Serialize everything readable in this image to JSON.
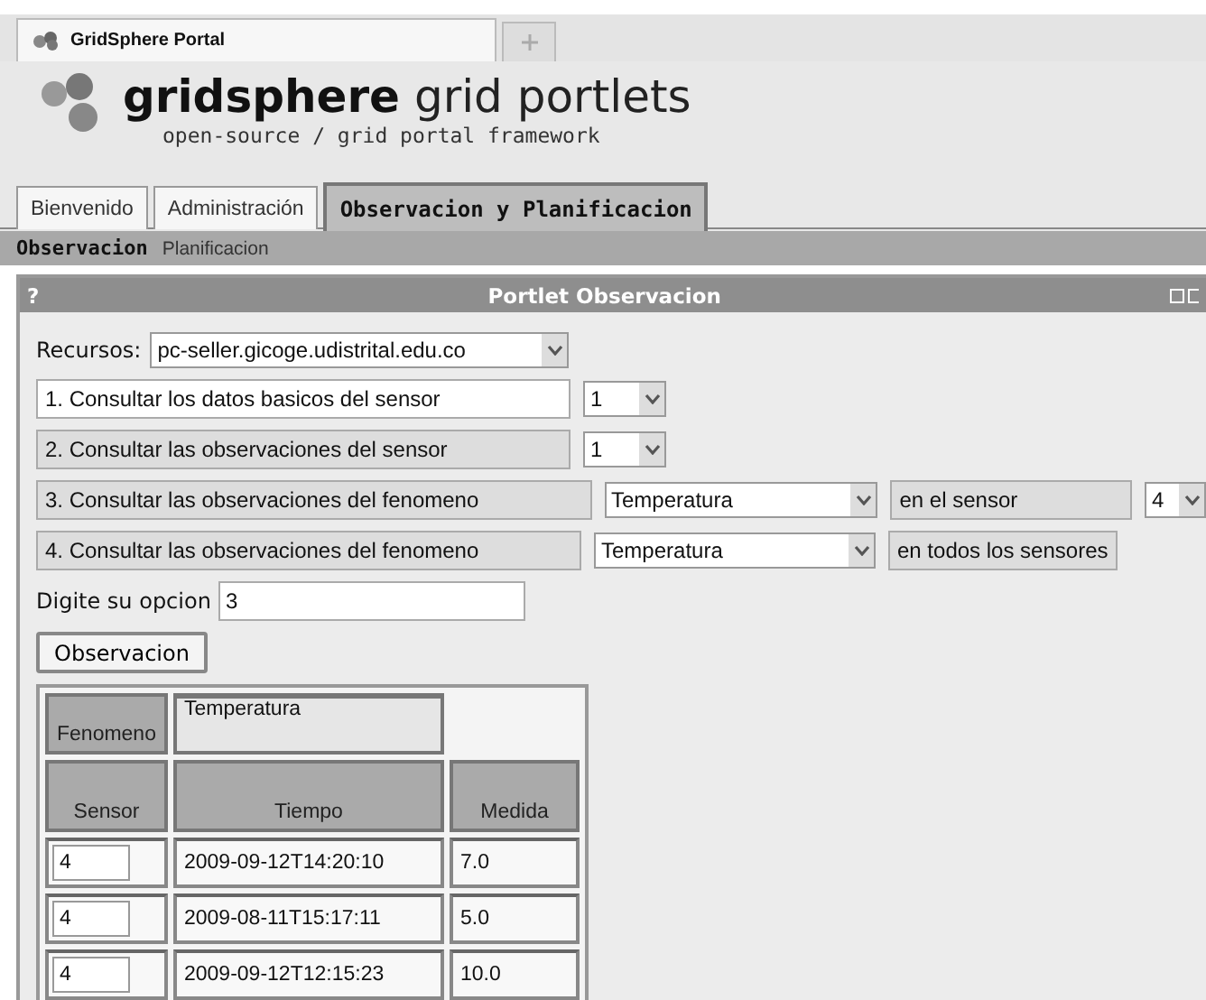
{
  "browser_tab": {
    "title": "GridSphere Portal"
  },
  "header": {
    "title": "**gridsphere** grid portlets",
    "subtitle": "open-source / grid portal framework"
  },
  "tabs": [
    {
      "label": "Bienvenido",
      "selected": false
    },
    {
      "label": "Administración",
      "selected": false
    },
    {
      "label": "Observacion y Planificacion",
      "selected": true
    }
  ],
  "subtabs": [
    {
      "label": "Observacion",
      "selected": true
    },
    {
      "label": "Planificacion",
      "selected": false
    }
  ],
  "portlet": {
    "help": "?",
    "title": "Portlet Observacion",
    "resource": {
      "label": "Recursos:",
      "value": "pc-seller.gicoge.udistrital.edu.co"
    },
    "options": [
      {
        "label": "1. Consultar los datos basicos del sensor",
        "active": true,
        "select": "1"
      },
      {
        "label": "2. Consultar las observaciones del sensor",
        "active": false,
        "select": "1"
      },
      {
        "label": "3. Consultar las observaciones del fenomeno",
        "active": false,
        "select": "Temperatura",
        "suffix": "en el sensor",
        "suffix_select": "4"
      },
      {
        "label": "4. Consultar las observaciones del fenomeno",
        "active": false,
        "select": "Temperatura",
        "suffix": "en todos los sensores"
      }
    ],
    "choice": {
      "label": "Digite su opcion",
      "value": "3"
    },
    "button": "Observacion",
    "table": {
      "phenomenon_label": "Fenomeno",
      "phenomenon": "Temperatura",
      "columns": [
        "Sensor",
        "Tiempo",
        "Medida"
      ],
      "rows": [
        [
          "4",
          "2009-09-12T14:20:10",
          "7.0"
        ],
        [
          "4",
          "2009-08-11T15:17:11",
          "5.0"
        ],
        [
          "4",
          "2009-09-12T12:15:23",
          "10.0"
        ]
      ]
    }
  }
}
